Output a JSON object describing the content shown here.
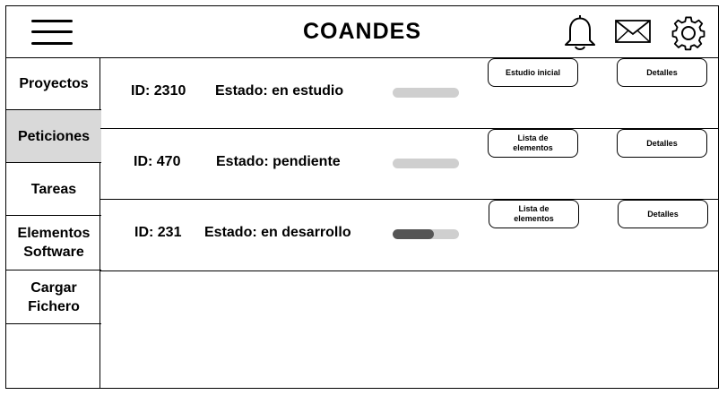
{
  "header": {
    "title": "COANDES",
    "icons": [
      "menu-icon",
      "bell-icon",
      "mail-icon",
      "gear-icon"
    ]
  },
  "sidebar": {
    "items": [
      {
        "label": "Proyectos",
        "active": false
      },
      {
        "label": "Peticiones",
        "active": true
      },
      {
        "label": "Tareas",
        "active": false
      },
      {
        "label": "Elementos\nSoftware",
        "active": false
      },
      {
        "label": "Cargar\nFichero",
        "active": false
      }
    ]
  },
  "requests": [
    {
      "id": "ID: 2310",
      "estado": "Estado: en estudio",
      "progress": 0.0,
      "action_label": "Estudio inicial",
      "details_label": "Detalles"
    },
    {
      "id": "ID: 470",
      "estado": "Estado: pendiente",
      "progress": 0.0,
      "action_label": "Lista de\nelementos",
      "details_label": "Detalles"
    },
    {
      "id": "ID: 231",
      "estado": "Estado: en desarrollo",
      "progress": 0.62,
      "action_label": "Lista de\nelementos",
      "details_label": "Detalles"
    }
  ],
  "colors": {
    "active_sidebar": "#d9d9d9",
    "progress_track": "#cfcfcf",
    "progress_fill": "#555555"
  }
}
